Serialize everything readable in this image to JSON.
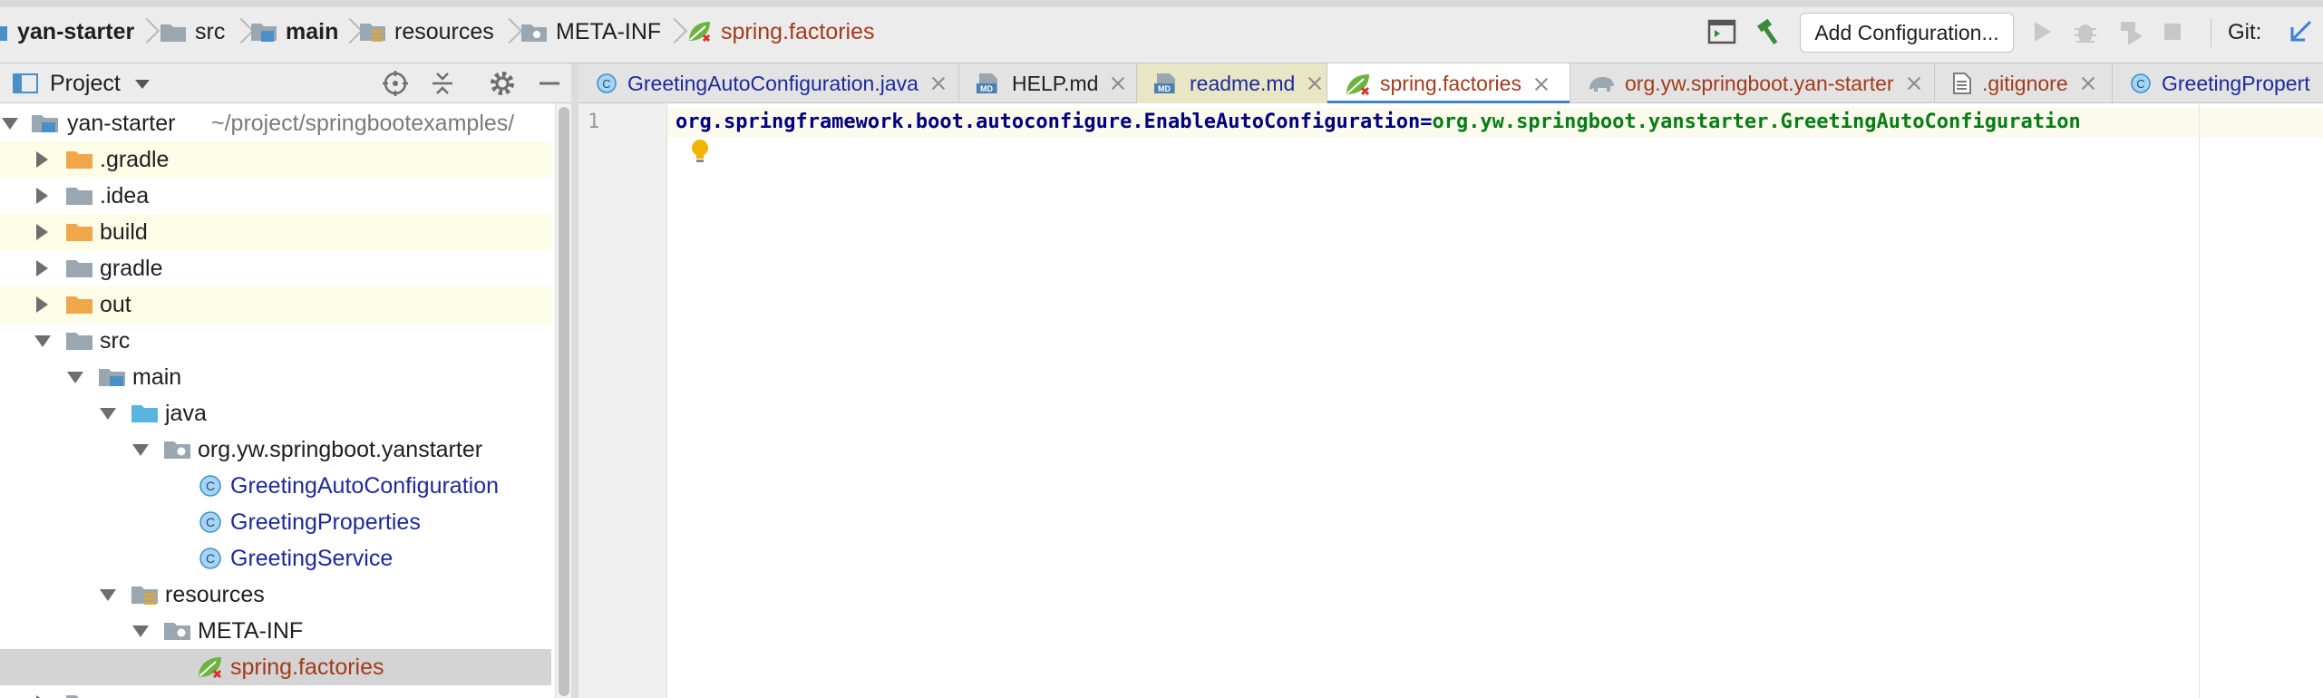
{
  "breadcrumb": {
    "items": [
      {
        "label": "yan-starter",
        "icon": "module-icon"
      },
      {
        "label": "src",
        "icon": "folder-icon"
      },
      {
        "label": "main",
        "icon": "source-folder-icon"
      },
      {
        "label": "resources",
        "icon": "resources-folder-icon"
      },
      {
        "label": "META-INF",
        "icon": "package-folder-icon"
      },
      {
        "label": "spring.factories",
        "icon": "spring-leaf-icon"
      }
    ]
  },
  "toolbar": {
    "add_config_label": "Add Configuration...",
    "git_label": "Git:"
  },
  "project_panel": {
    "title": "Project"
  },
  "tree": {
    "root_label": "yan-starter",
    "root_path": "~/project/springbootexamples/",
    "items": [
      {
        "label": ".gradle"
      },
      {
        "label": ".idea"
      },
      {
        "label": "build"
      },
      {
        "label": "gradle"
      },
      {
        "label": "out"
      },
      {
        "label": "src"
      },
      {
        "label": "main"
      },
      {
        "label": "java"
      },
      {
        "label": "org.yw.springboot.yanstarter"
      },
      {
        "label": "GreetingAutoConfiguration"
      },
      {
        "label": "GreetingProperties"
      },
      {
        "label": "GreetingService"
      },
      {
        "label": "resources"
      },
      {
        "label": "META-INF"
      },
      {
        "label": "spring.factories"
      }
    ]
  },
  "tabs": [
    {
      "label": "GreetingAutoConfiguration.java",
      "active": false
    },
    {
      "label": "HELP.md",
      "active": false
    },
    {
      "label": "readme.md",
      "active": false
    },
    {
      "label": "spring.factories",
      "active": true
    },
    {
      "label": "org.yw.springboot.yan-starter",
      "active": false
    },
    {
      "label": ".gitignore",
      "active": false
    },
    {
      "label": "GreetingPropert",
      "active": false
    }
  ],
  "editor": {
    "line_number": "1",
    "key_text": "org.springframework.boot.autoconfigure.EnableAutoConfiguration",
    "equals": "=",
    "value_text": "org.yw.springboot.yanstarter.GreetingAutoConfiguration"
  },
  "colors": {
    "accent": "#4083c9",
    "class_text": "#1d2a9c",
    "spring_text": "#a33b1b",
    "md_text": "#1d2a9c"
  }
}
